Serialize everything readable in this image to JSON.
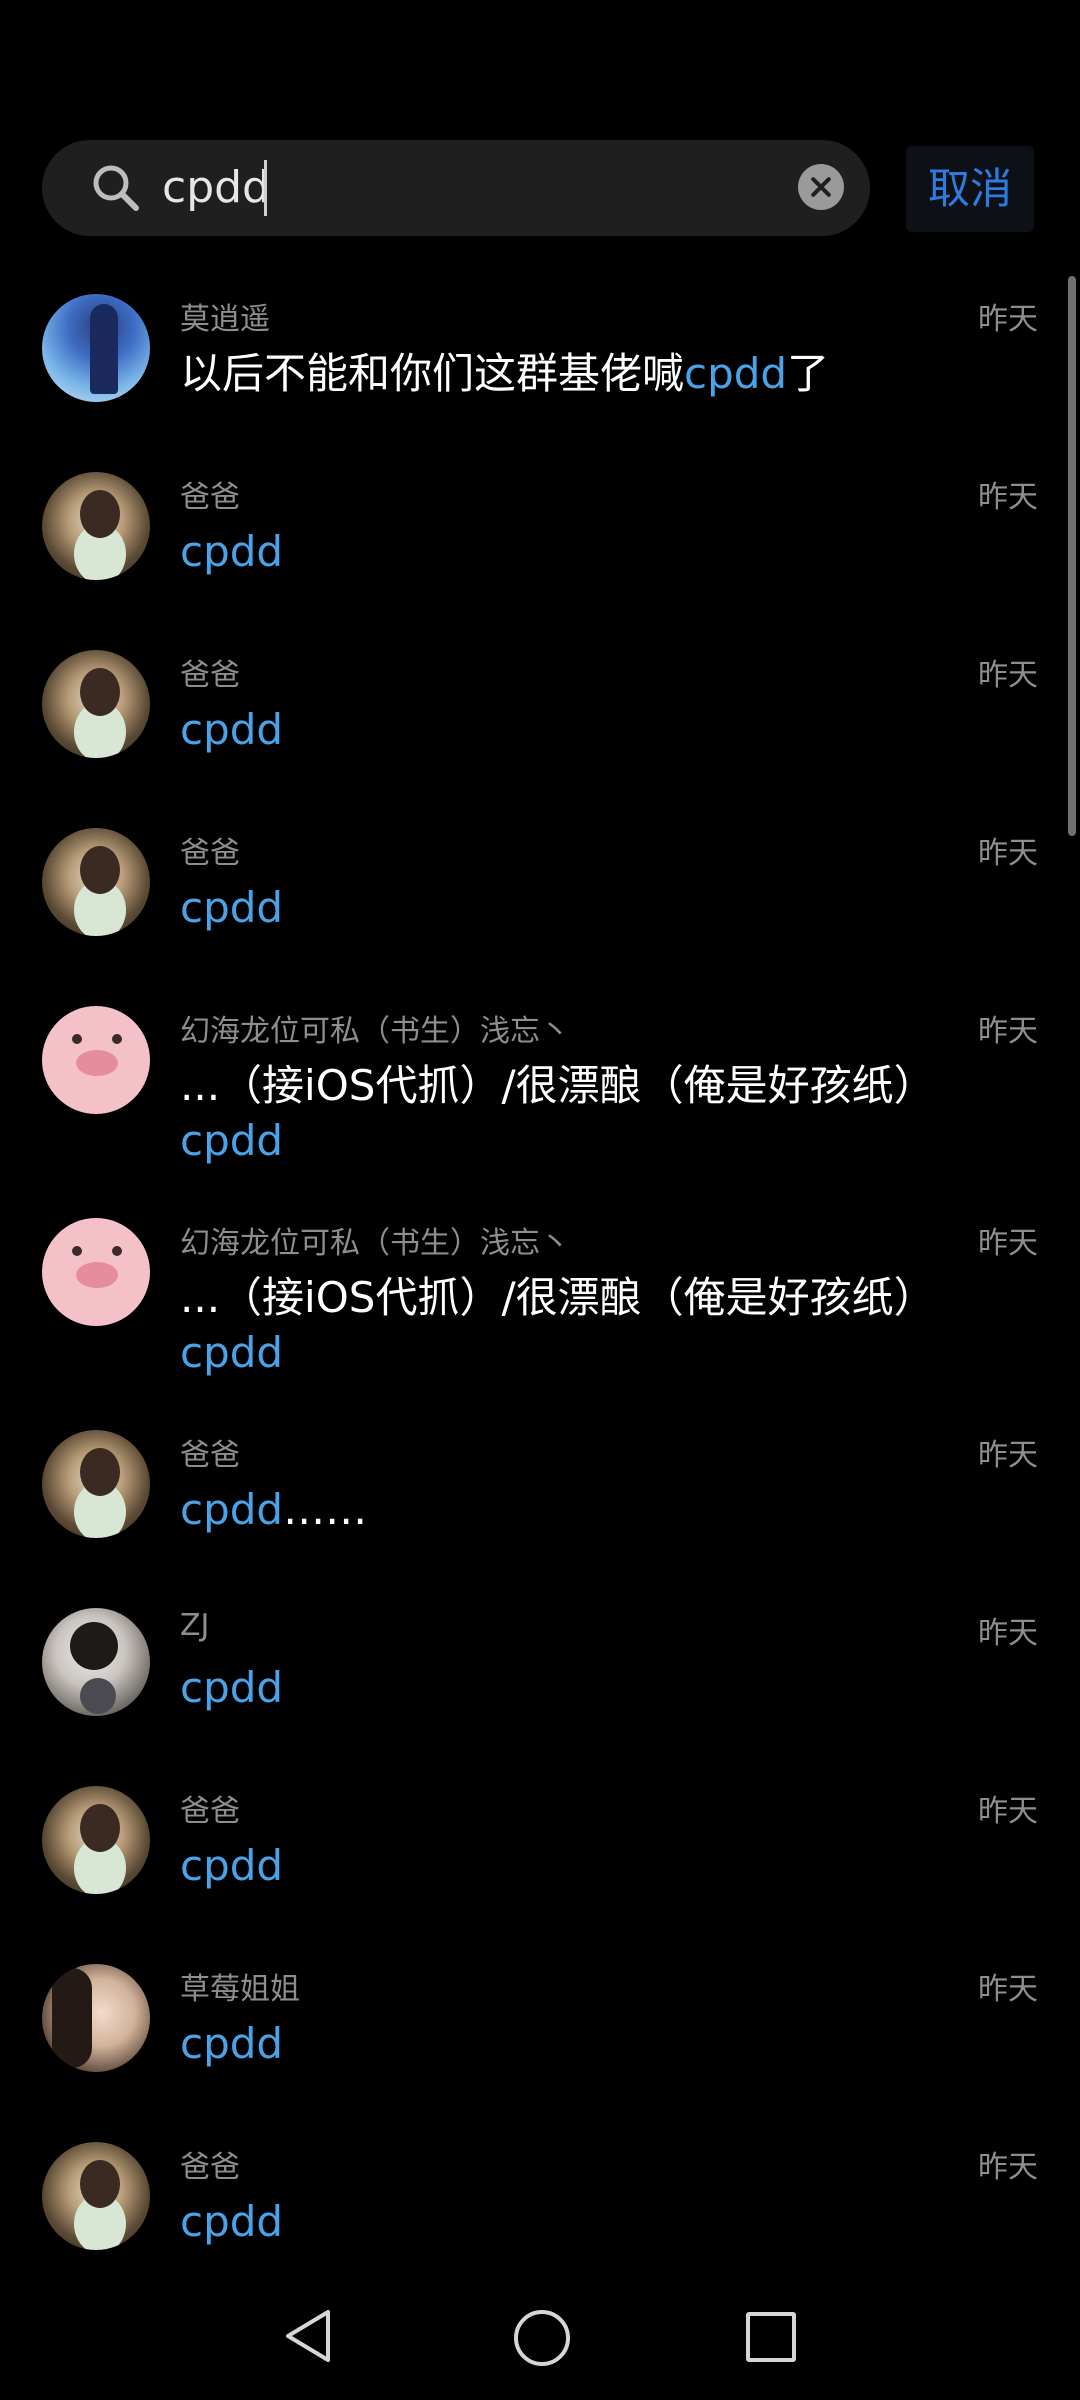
{
  "search": {
    "value": "cpdd",
    "cancel_label": "取消"
  },
  "results": [
    {
      "avatar": "anime-character-avatar",
      "sender": "莫逍遥",
      "time": "昨天",
      "message_before": "以后不能和你们这群基佬喊",
      "message_highlight": "cpdd",
      "message_after": "了"
    },
    {
      "avatar": "girl-photo-avatar",
      "sender": "爸爸",
      "time": "昨天",
      "message_before": "",
      "message_highlight": "cpdd",
      "message_after": ""
    },
    {
      "avatar": "girl-photo-avatar",
      "sender": "爸爸",
      "time": "昨天",
      "message_before": "",
      "message_highlight": "cpdd",
      "message_after": ""
    },
    {
      "avatar": "girl-photo-avatar",
      "sender": "爸爸",
      "time": "昨天",
      "message_before": "",
      "message_highlight": "cpdd",
      "message_after": ""
    },
    {
      "avatar": "pig-face-avatar",
      "sender": "幻海龙位可私（书生）浅忘丶",
      "time": "昨天",
      "message_line1": "...（接iOS代抓）/很漂酿（俺是好孩纸）",
      "message_highlight": "cpdd"
    },
    {
      "avatar": "pig-face-avatar",
      "sender": "幻海龙位可私（书生）浅忘丶",
      "time": "昨天",
      "message_line1": "...（接iOS代抓）/很漂酿（俺是好孩纸）",
      "message_highlight": "cpdd"
    },
    {
      "avatar": "girl-photo-avatar",
      "sender": "爸爸",
      "time": "昨天",
      "message_before": "",
      "message_highlight": "cpdd",
      "message_after": "……"
    },
    {
      "avatar": "man-photo-avatar",
      "sender": "ZJ",
      "time": "昨天",
      "message_before": "",
      "message_highlight": "cpdd",
      "message_after": ""
    },
    {
      "avatar": "girl-photo-avatar",
      "sender": "爸爸",
      "time": "昨天",
      "message_before": "",
      "message_highlight": "cpdd",
      "message_after": ""
    },
    {
      "avatar": "woman-photo-avatar",
      "sender": "草莓姐姐",
      "time": "昨天",
      "message_before": "",
      "message_highlight": "cpdd",
      "message_after": ""
    },
    {
      "avatar": "girl-photo-avatar",
      "sender": "爸爸",
      "time": "昨天",
      "message_before": "",
      "message_highlight": "cpdd",
      "message_after": ""
    }
  ],
  "nav": {
    "back_icon": "back-triangle-icon",
    "home_icon": "home-circle-icon",
    "recents_icon": "recents-square-icon"
  },
  "colors": {
    "background": "#000000",
    "highlight": "#4aa3e8",
    "cancel": "#2f7ce0",
    "secondary_text": "#8e8e8e"
  }
}
